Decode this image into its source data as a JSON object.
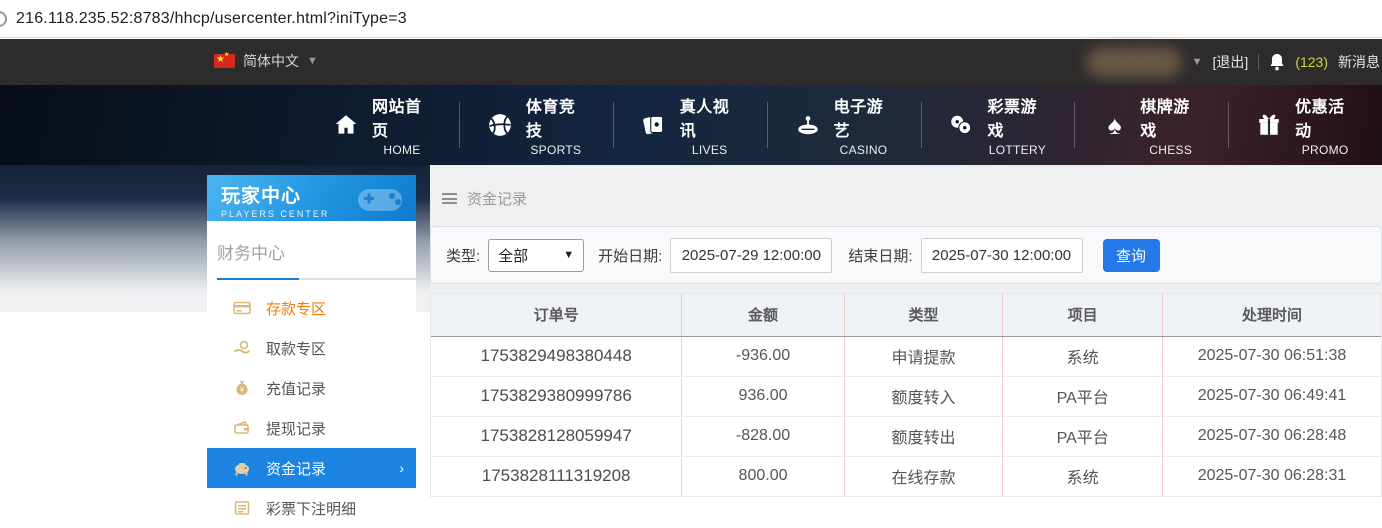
{
  "browser": {
    "url": "216.118.235.52:8783/hhcp/usercenter.html?iniType=3"
  },
  "topbar": {
    "language": "简体中文",
    "logout": "[退出]",
    "message_count": "(123)",
    "message_label": "新消息"
  },
  "nav": {
    "items": [
      {
        "cn": "网站首页",
        "en": "HOME"
      },
      {
        "cn": "体育竞技",
        "en": "SPORTS"
      },
      {
        "cn": "真人视讯",
        "en": "LIVES"
      },
      {
        "cn": "电子游艺",
        "en": "CASINO"
      },
      {
        "cn": "彩票游戏",
        "en": "LOTTERY"
      },
      {
        "cn": "棋牌游戏",
        "en": "CHESS"
      },
      {
        "cn": "优惠活动",
        "en": "PROMO"
      }
    ]
  },
  "sidebar": {
    "title": "玩家中心",
    "subtitle": "PLAYERS CENTER",
    "section": "财务中心",
    "items": [
      {
        "label": "存款专区"
      },
      {
        "label": "取款专区"
      },
      {
        "label": "充值记录"
      },
      {
        "label": "提现记录"
      },
      {
        "label": "资金记录"
      },
      {
        "label": "彩票下注明细"
      }
    ],
    "active_arrow": "›"
  },
  "main": {
    "breadcrumb": "资金记录",
    "filter": {
      "type_label": "类型:",
      "type_value": "全部",
      "start_label": "开始日期:",
      "start_value": "2025-07-29 12:00:00",
      "end_label": "结束日期:",
      "end_value": "2025-07-30 12:00:00",
      "search_label": "查询"
    },
    "table": {
      "headers": [
        "订单号",
        "金额",
        "类型",
        "项目",
        "处理时间"
      ],
      "rows": [
        [
          "1753829498380448",
          "-936.00",
          "申请提款",
          "系统",
          "2025-07-30 06:51:38"
        ],
        [
          "1753829380999786",
          "936.00",
          "额度转入",
          "PA平台",
          "2025-07-30 06:49:41"
        ],
        [
          "1753828128059947",
          "-828.00",
          "额度转出",
          "PA平台",
          "2025-07-30 06:28:48"
        ],
        [
          "1753828111319208",
          "800.00",
          "在线存款",
          "系统",
          "2025-07-30 06:28:31"
        ]
      ]
    }
  },
  "colors": {
    "accent_blue": "#2678e8",
    "sidebar_active_blue": "#1b84e3",
    "highlight_orange": "#f57c00",
    "message_yellow": "#cddc39",
    "table_vline_pink": "#f5caca"
  }
}
